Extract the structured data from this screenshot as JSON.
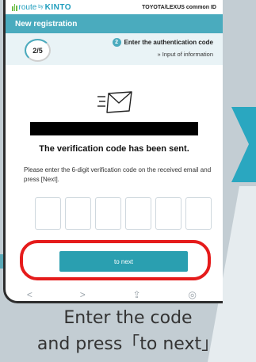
{
  "logo": {
    "brand": "route",
    "by": "by",
    "company": "KINTO"
  },
  "topbar": {
    "common_id": "TOYOTA/LEXUS common ID"
  },
  "header": {
    "title": "New registration"
  },
  "steps": {
    "progress": "2/5",
    "current_number": "2",
    "current_label": "Enter the authentication code",
    "next_label": "» Input of information"
  },
  "message": {
    "title": "The verification code has been sent.",
    "instructions": "Please enter the 6-digit verification code on the received email and press [Next]."
  },
  "code_boxes": [
    "",
    "",
    "",
    "",
    "",
    ""
  ],
  "next_button": {
    "label": "to next"
  },
  "toolbar": {
    "back": "<",
    "forward": ">",
    "share": "⇪",
    "compass": "◎"
  },
  "caption": {
    "line1": "Enter the code",
    "line2": "and press「to next」"
  }
}
